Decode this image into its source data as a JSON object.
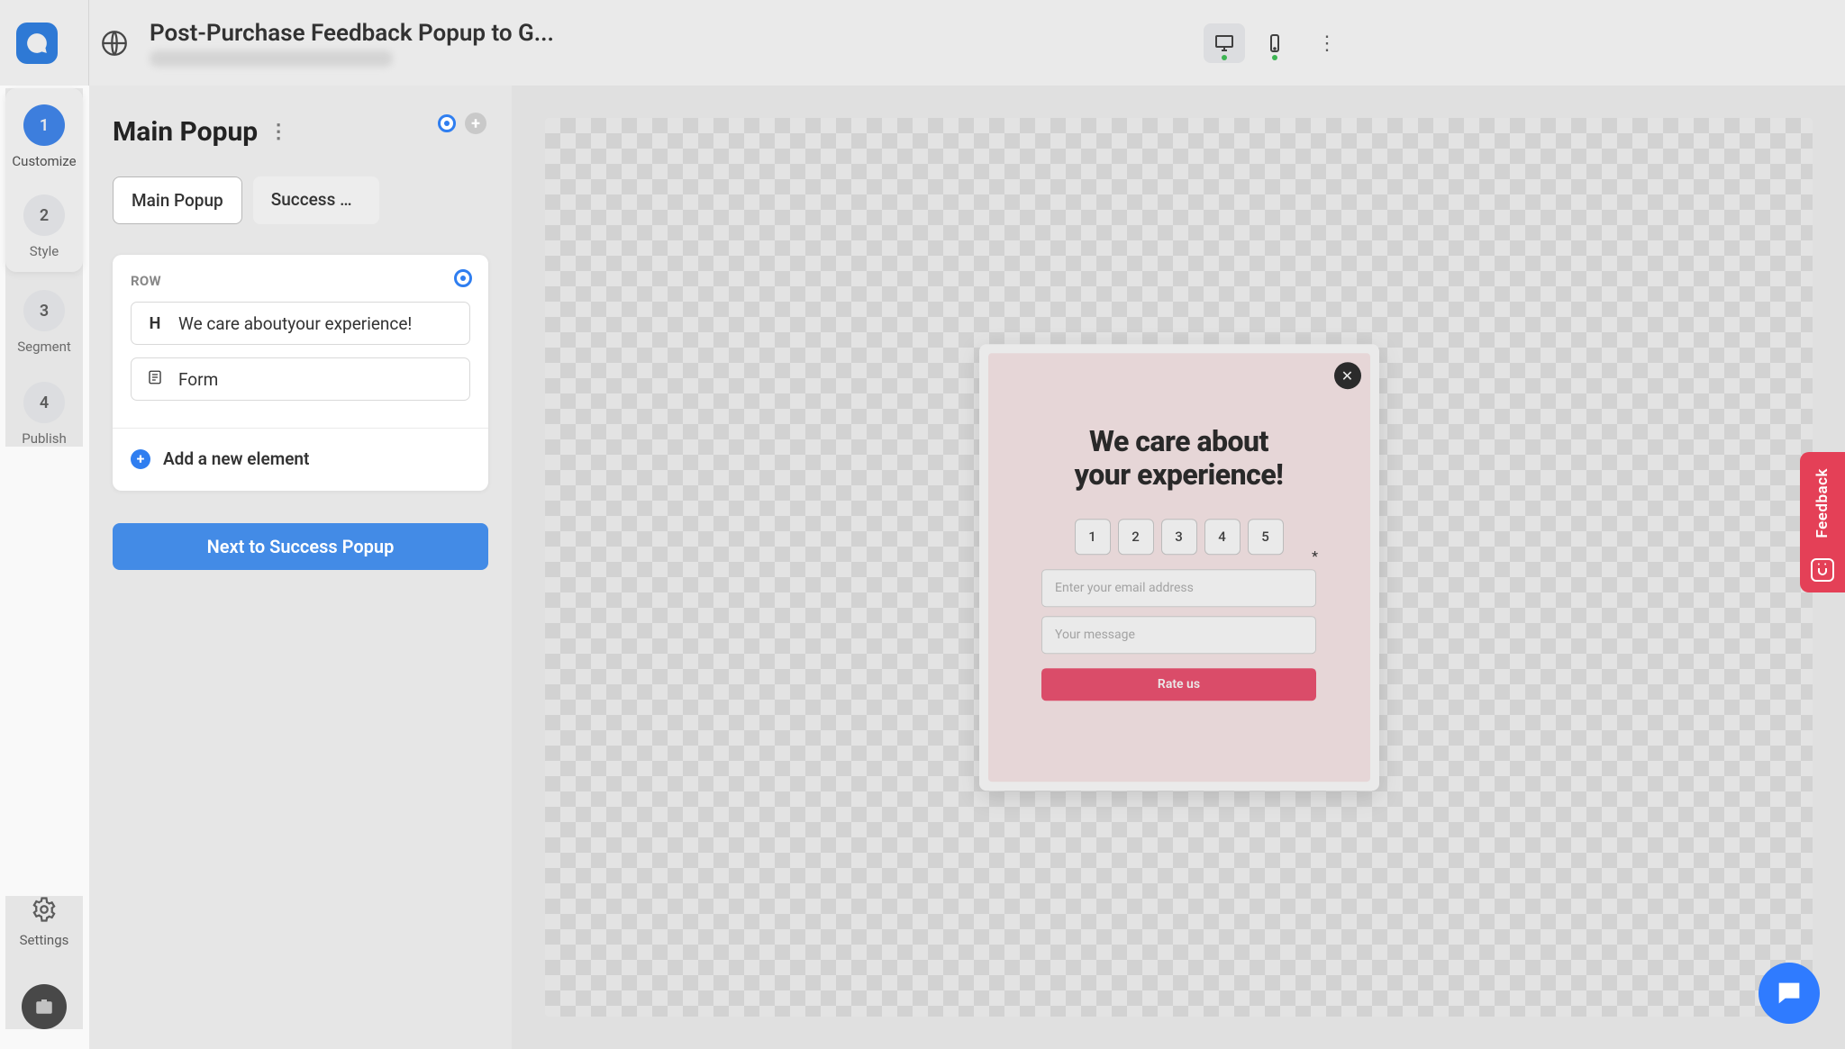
{
  "header": {
    "title": "Post-Purchase Feedback Popup to G..."
  },
  "steps": [
    {
      "num": "1",
      "label": "Customize"
    },
    {
      "num": "2",
      "label": "Style"
    },
    {
      "num": "3",
      "label": "Segment"
    },
    {
      "num": "4",
      "label": "Publish"
    }
  ],
  "settings_label": "Settings",
  "editor": {
    "title": "Main Popup",
    "tab_main": "Main Popup",
    "tab_success": "Success Po…",
    "row_label": "ROW",
    "item_heading": "We care aboutyour experience!",
    "item_form": "Form",
    "add_element": "Add a new element",
    "next_button": "Next to Success Popup"
  },
  "popup": {
    "heading_l1": "We care about",
    "heading_l2": "your experience!",
    "ratings": [
      "1",
      "2",
      "3",
      "4",
      "5"
    ],
    "email_placeholder": "Enter your email address",
    "message_placeholder": "Your message",
    "submit": "Rate us"
  },
  "feedback_tab": "Feedback"
}
